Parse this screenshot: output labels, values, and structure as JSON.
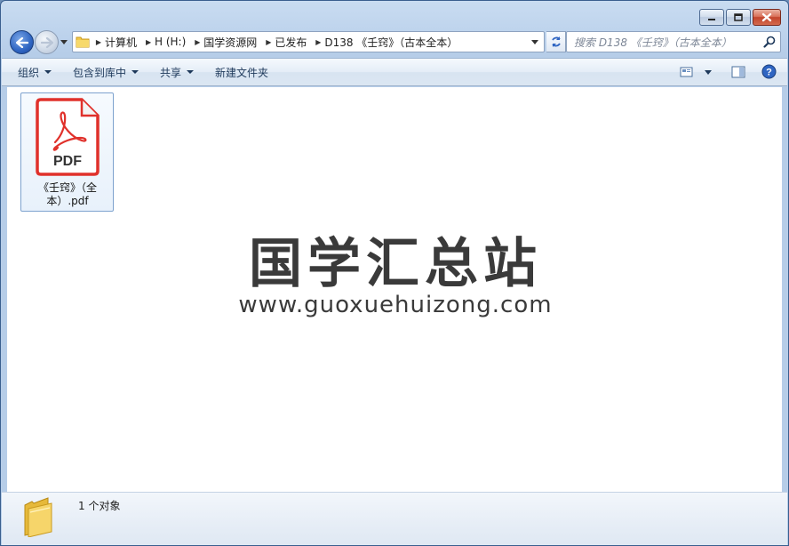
{
  "window": {
    "caption_buttons": [
      "minimize",
      "maximize",
      "close"
    ]
  },
  "nav": {
    "breadcrumbs": [
      "计算机",
      "H (H:)",
      "国学资源网",
      "已发布",
      "D138 《壬窍》（古本全本）"
    ],
    "search_placeholder": "搜索 D138 《壬窍》（古本全本）"
  },
  "toolbar": {
    "organize": "组织",
    "include_in_library": "包含到库中",
    "share": "共享",
    "new_folder": "新建文件夹"
  },
  "files": [
    {
      "name": "《壬窍》（全本）.pdf",
      "icon_label": "PDF",
      "icon": "pdf-file-icon"
    }
  ],
  "watermark": {
    "title": "国学汇总站",
    "url": "www.guoxuehuizong.com"
  },
  "status": {
    "count_text": "1 个对象"
  },
  "colors": {
    "accent": "#2f65c2",
    "pdf_red": "#e0312b"
  }
}
